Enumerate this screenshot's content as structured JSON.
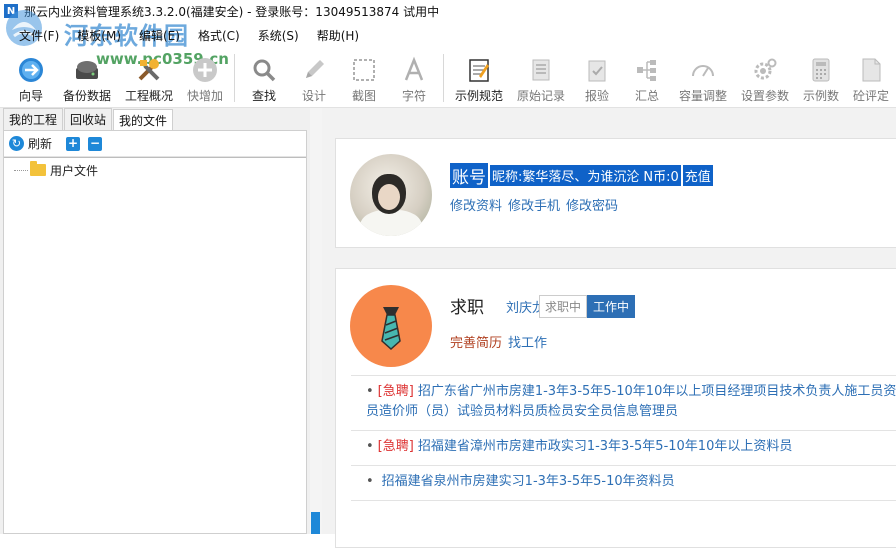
{
  "window": {
    "title": "那云内业资料管理系统3.3.2.0(福建安全) - 登录账号：13049513874 试用中"
  },
  "watermark": {
    "title": "河东软件园",
    "url": "www.pc0359.cn"
  },
  "menu": [
    "文件(F)",
    "模板(M)",
    "编辑(E)",
    "格式(C)",
    "系统(S)",
    "帮助(H)"
  ],
  "toolbar": {
    "guide": "向导",
    "backup": "备份数据",
    "overview": "工程概况",
    "quick_add": "快增加",
    "find": "查找",
    "design": "设计",
    "screenshot": "截图",
    "char": "字符",
    "example_spec": "示例规范",
    "raw_record": "原始记录",
    "inspection": "报验",
    "summary": "汇总",
    "capacity": "容量调整",
    "settings": "设置参数",
    "example_num": "示例数",
    "concrete": "砼评定"
  },
  "left_panel": {
    "tabs": [
      "我的工程",
      "回收站",
      "我的文件"
    ],
    "active_tab": 2,
    "refresh": "刷新",
    "add": "+",
    "remove": "−",
    "tree_root": "用户文件"
  },
  "profile": {
    "account_label": "账号",
    "nickname": "昵称:繁华落尽、为谁沉沦",
    "coins": "N币:0",
    "recharge": "充值",
    "links": [
      "修改资料",
      "修改手机",
      "修改密码"
    ]
  },
  "job": {
    "title": "求职",
    "name": "刘庆龙",
    "status_options": [
      "求职中",
      "工作中"
    ],
    "active_status": 1,
    "links": [
      "完善简历",
      "找工作"
    ],
    "listings": [
      {
        "urgent": "[急聘]",
        "text": "招广东省广州市房建1-3年3-5年5-10年10年以上项目经理项目技术负责人施工员资料员造价师（员）试验员材料员质检员安全员信息管理员"
      },
      {
        "urgent": "[急聘]",
        "text": "招福建省漳州市房建市政实习1-3年3-5年5-10年10年以上资料员"
      },
      {
        "urgent": "",
        "text": "招福建省泉州市房建实习1-3年3-5年5-10年资料员"
      }
    ]
  },
  "colors": {
    "accent": "#1e88d8",
    "selection": "#0f62c8",
    "link": "#2d6fb5",
    "urgent": "#dd3333",
    "tie_bg": "#f7884b"
  }
}
